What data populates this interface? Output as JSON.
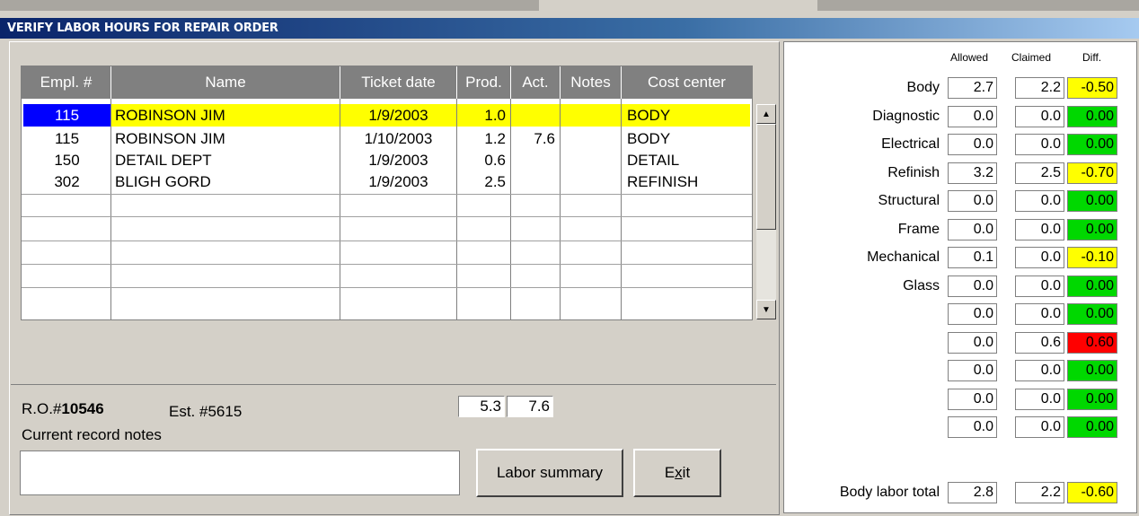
{
  "window": {
    "title": "VERIFY LABOR HOURS FOR REPAIR ORDER"
  },
  "grid": {
    "columns": [
      "Empl. #",
      "Name",
      "Ticket date",
      "Prod.",
      "Act.",
      "Notes",
      "Cost center"
    ],
    "rows": [
      {
        "empl": "115",
        "name": "ROBINSON JIM",
        "date": "1/9/2003",
        "prod": "1.0",
        "act": "",
        "notes": "",
        "cost": "BODY"
      },
      {
        "empl": "115",
        "name": "ROBINSON JIM",
        "date": "1/10/2003",
        "prod": "1.2",
        "act": "7.6",
        "notes": "",
        "cost": "BODY"
      },
      {
        "empl": "150",
        "name": "DETAIL DEPT",
        "date": "1/9/2003",
        "prod": "0.6",
        "act": "",
        "notes": "",
        "cost": "DETAIL"
      },
      {
        "empl": "302",
        "name": "BLIGH GORD",
        "date": "1/9/2003",
        "prod": "2.5",
        "act": "",
        "notes": "",
        "cost": "REFINISH"
      }
    ],
    "scroll_up_icon": "triangle-up-icon",
    "scroll_down_icon": "triangle-down-icon"
  },
  "footer": {
    "ro_label": "R.O.#",
    "ro_number": "10546",
    "est_label": "Est. #5615",
    "prod_total": "5.3",
    "act_total": "7.6",
    "notes_label": "Current record notes",
    "notes_value": "",
    "labor_summary_label": "Labor summary",
    "exit_label": "Exit"
  },
  "summary": {
    "headers": {
      "allowed": "Allowed",
      "claimed": "Claimed",
      "diff": "Diff."
    },
    "rows": [
      {
        "label": "Body",
        "allowed": "2.7",
        "claimed": "2.2",
        "diff": "-0.50",
        "status": "warn"
      },
      {
        "label": "Diagnostic",
        "allowed": "0.0",
        "claimed": "0.0",
        "diff": "0.00",
        "status": "ok"
      },
      {
        "label": "Electrical",
        "allowed": "0.0",
        "claimed": "0.0",
        "diff": "0.00",
        "status": "ok"
      },
      {
        "label": "Refinish",
        "allowed": "3.2",
        "claimed": "2.5",
        "diff": "-0.70",
        "status": "warn"
      },
      {
        "label": "Structural",
        "allowed": "0.0",
        "claimed": "0.0",
        "diff": "0.00",
        "status": "ok"
      },
      {
        "label": "Frame",
        "allowed": "0.0",
        "claimed": "0.0",
        "diff": "0.00",
        "status": "ok"
      },
      {
        "label": "Mechanical",
        "allowed": "0.1",
        "claimed": "0.0",
        "diff": "-0.10",
        "status": "warn"
      },
      {
        "label": "Glass",
        "allowed": "0.0",
        "claimed": "0.0",
        "diff": "0.00",
        "status": "ok"
      },
      {
        "label": "",
        "allowed": "0.0",
        "claimed": "0.0",
        "diff": "0.00",
        "status": "ok"
      },
      {
        "label": "",
        "allowed": "0.0",
        "claimed": "0.6",
        "diff": "0.60",
        "status": "error"
      },
      {
        "label": "",
        "allowed": "0.0",
        "claimed": "0.0",
        "diff": "0.00",
        "status": "ok"
      },
      {
        "label": "",
        "allowed": "0.0",
        "claimed": "0.0",
        "diff": "0.00",
        "status": "ok"
      },
      {
        "label": "",
        "allowed": "0.0",
        "claimed": "0.0",
        "diff": "0.00",
        "status": "ok"
      }
    ],
    "total": {
      "label": "Body labor total",
      "allowed": "2.8",
      "claimed": "2.2",
      "diff": "-0.60",
      "status": "warn"
    }
  },
  "colors": {
    "ok": "#00d800",
    "warn": "#ffff00",
    "error": "#ff0000",
    "selected_row": "#ffff00",
    "selected_cell": "#0000ff",
    "titlebar": "#0a246a"
  }
}
